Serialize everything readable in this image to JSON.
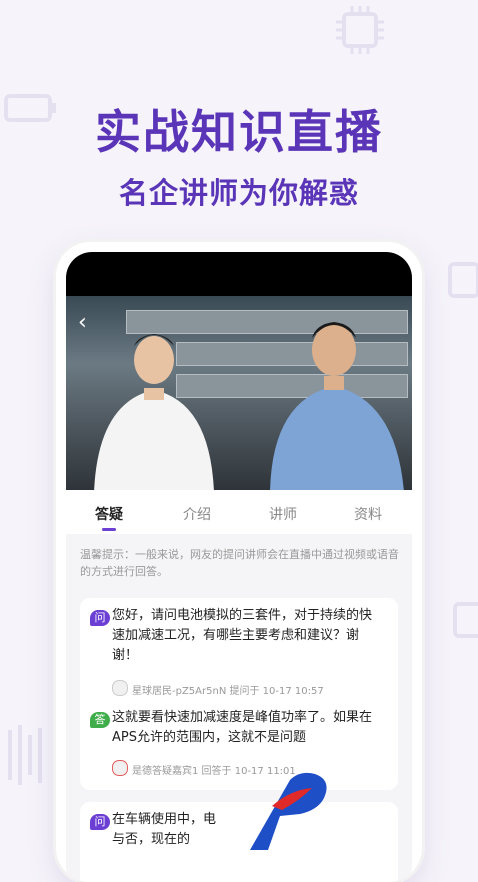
{
  "hero": {
    "title": "实战知识直播",
    "subtitle": "名企讲师为你解惑"
  },
  "player": {
    "back_icon": "back-arrow-icon"
  },
  "tabs": [
    {
      "label": "答疑",
      "active": true
    },
    {
      "label": "介绍",
      "active": false
    },
    {
      "label": "讲师",
      "active": false
    },
    {
      "label": "资料",
      "active": false
    }
  ],
  "tip": "温馨提示：一般来说，网友的提问讲师会在直播中通过视频或语音的方式进行回答。",
  "qa": [
    {
      "question": {
        "badge": "问",
        "text": "您好，请问电池模拟的三套件，对于持续的快速加减速工况，有哪些主要考虑和建议？谢谢！",
        "meta": "星球居民-pZ5Ar5nN  提问于  10-17 10:57"
      },
      "answer": {
        "badge": "答",
        "text": "这就要看快速加减速度是峰值功率了。如果在APS允许的范围内，这就不是问题",
        "meta": "是德答疑嘉宾1  回答于  10-17 11:01"
      }
    },
    {
      "question": {
        "badge": "问",
        "text": "在车辆使用中，电与否，现在的",
        "meta": ""
      }
    }
  ],
  "colors": {
    "brand": "#5b35b8",
    "question_badge": "#6b3fd3",
    "answer_badge": "#3fae4a"
  }
}
